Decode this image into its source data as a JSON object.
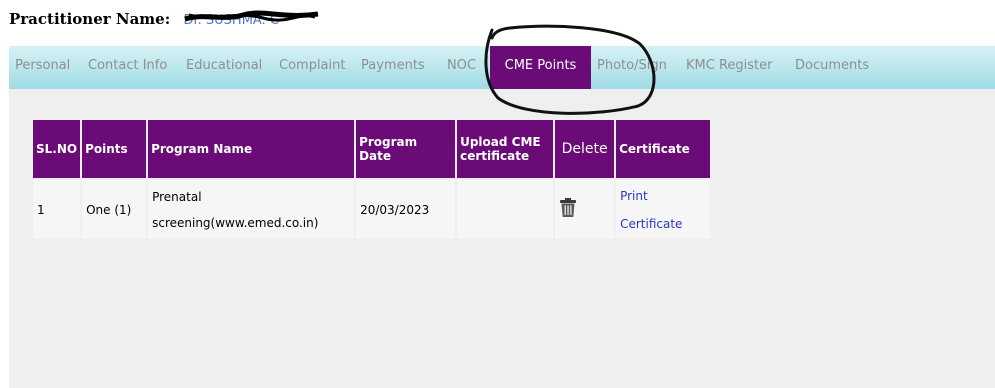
{
  "practitioner": {
    "label": "Practitioner Name:",
    "value": "Dr. SUSHMA. C"
  },
  "tabs": [
    "Personal",
    "Contact Info",
    "Educational",
    "Complaint",
    "Payments",
    "NOC",
    "CME Points",
    "Photo/Sign",
    "KMC Register",
    "Documents"
  ],
  "active_tab": "CME Points",
  "table": {
    "headers": [
      "SL.NO",
      "Points",
      "Program Name",
      "Program Date",
      "Upload CME certificate",
      "Delete",
      "Certificate"
    ],
    "rows": [
      {
        "sl": "1",
        "points": "One (1)",
        "program_line1": "Prenatal",
        "program_line2": "screening(www.emed.co.in)",
        "date": "20/03/2023",
        "upload": "",
        "delete_icon": "trash-icon",
        "cert_line1": "Print",
        "cert_line2": "Certificate"
      }
    ]
  },
  "colors": {
    "tab_active": "#6b0b78",
    "header_bg": "#6b0b78",
    "link": "#2a36c8",
    "tabbar": "#bfe8ee"
  }
}
